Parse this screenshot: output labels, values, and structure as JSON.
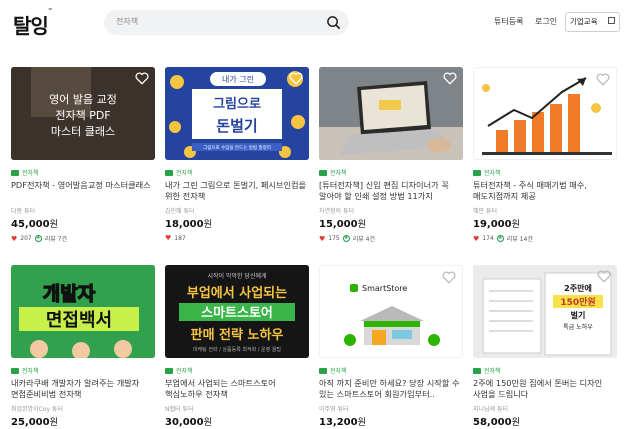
{
  "header": {
    "logo": "탈잉",
    "logo_tm": "™",
    "search_placeholder": "전자책",
    "nav_tutor": "튜터등록",
    "nav_login": "로그인",
    "nav_biz": "기업교육"
  },
  "cards": [
    {
      "tag": "전자책",
      "title": "PDF전자책 - 영어발음교정 마스터클래스",
      "author": "다봉 튜터",
      "price": "45,000",
      "won": "원",
      "likes": "207",
      "review": "리뷰 7건",
      "thumb_text": [
        "영어 발음 교정",
        "전자책 PDF",
        "마스터 클래스"
      ]
    },
    {
      "tag": "전자책",
      "title": "내가 그린 그림으로 돈벌기, 페시브인컴을 위한 전자책",
      "author": "김민혜 튜터",
      "price": "18,000",
      "won": "원",
      "likes": "187",
      "review": "",
      "thumb_text": [
        "내가 그린",
        "그림으로",
        "돈벌기",
        "그림으로 수입을 만드는 방법 총정리"
      ]
    },
    {
      "tag": "전자책",
      "title": "[튜터전자책] 신입 편집 디자이너가 꼭 알아야 할 인쇄 설정 방법 11가지",
      "author": "차연정의 튜터",
      "price": "15,000",
      "won": "원",
      "likes": "175",
      "review": "리뷰 4건",
      "thumb_text": []
    },
    {
      "tag": "전자책",
      "title": "튜터전자책 - 주식 매매기법 매수, 매도지점까지 제공",
      "author": "혜안 튜터",
      "price": "19,000",
      "won": "원",
      "likes": "174",
      "review": "리뷰 14건",
      "thumb_text": []
    },
    {
      "tag": "전자책",
      "title": "내카라쿠배 개발자가 알려주는 개발자 면접준비비법 전자책",
      "author": "취업깡깡이Coy 튜터",
      "price": "25,000",
      "won": "원",
      "likes": "",
      "review": "",
      "thumb_text": [
        "개발자",
        "면접백서"
      ]
    },
    {
      "tag": "전자책",
      "title": "부업에서 사업되는 스마트스토어 핵심노하우 전자책",
      "author": "N랩터 튜터",
      "price": "30,000",
      "won": "원",
      "likes": "",
      "review": "",
      "thumb_text": [
        "시작이 막막한 당신에게",
        "부업에서 사업되는",
        "스마트스토어",
        "판매 전략 노하우",
        "마케팅 전략 / 상품등록 최적화 / 운영 꿀팁"
      ]
    },
    {
      "tag": "전자책",
      "title": "아직 까지 준비만 하세요? 당장 시작할 수 있는 스마트스토어 회원가입부터..",
      "author": "이주영 튜터",
      "price": "13,200",
      "won": "원",
      "likes": "",
      "review": "",
      "thumb_text": [
        "SmartStore"
      ]
    },
    {
      "tag": "전자책",
      "title": "2주에 150만원 집에서 돈버는 디자인 사업을 드립니다",
      "author": "지니님께 튜터",
      "price": "58,000",
      "won": "원",
      "likes": "",
      "review": "",
      "thumb_text": [
        "2주만에",
        "150만원",
        "벌기",
        "특급 노하우"
      ]
    }
  ]
}
